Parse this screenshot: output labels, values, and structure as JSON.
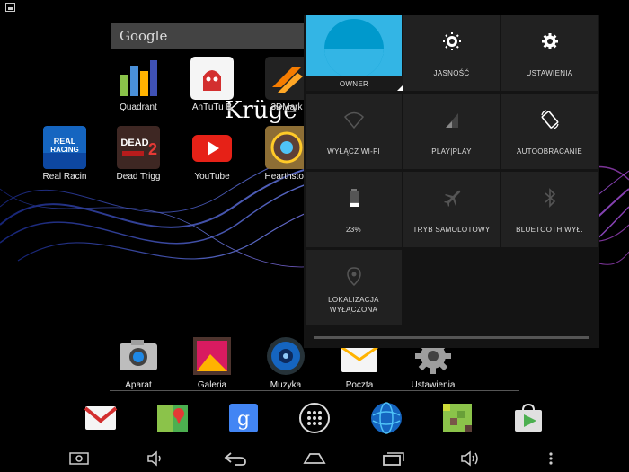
{
  "search": {
    "placeholder": "Google"
  },
  "wallpaper_text": "Krüge",
  "home_apps": [
    {
      "label": "Quadrant",
      "icon": "quadrant-icon",
      "color": "#4a90d9"
    },
    {
      "label": "AnTuTu B",
      "icon": "antutu-icon",
      "color": "#d32f2f"
    },
    {
      "label": "3DMark",
      "icon": "3dmark-icon",
      "color": "#f57c00"
    },
    {
      "label": "Real Racin",
      "icon": "real-racing-icon",
      "color": "#1565c0"
    },
    {
      "label": "Dead Trigg",
      "icon": "dead-trigger-icon",
      "color": "#b71c1c"
    },
    {
      "label": "YouTube",
      "icon": "youtube-icon",
      "color": "#e62117"
    },
    {
      "label": "Hearthston",
      "icon": "hearthstone-icon",
      "color": "#8d6e35"
    }
  ],
  "dock_apps": [
    {
      "label": "Aparat",
      "icon": "camera-icon"
    },
    {
      "label": "Galeria",
      "icon": "gallery-icon"
    },
    {
      "label": "Muzyka",
      "icon": "music-icon"
    },
    {
      "label": "Poczta",
      "icon": "mail-icon"
    },
    {
      "label": "Ustawienia",
      "icon": "settings-icon"
    }
  ],
  "hotseat": [
    {
      "icon": "gmail-icon"
    },
    {
      "icon": "maps-icon"
    },
    {
      "icon": "google-search-icon"
    },
    {
      "icon": "app-drawer-icon"
    },
    {
      "icon": "browser-globe-icon"
    },
    {
      "icon": "minecraft-icon"
    },
    {
      "icon": "play-store-icon"
    }
  ],
  "quick_settings": {
    "owner": {
      "label": "OWNER"
    },
    "brightness": {
      "label": "JASNOŚĆ",
      "icon": "brightness-icon"
    },
    "settings": {
      "label": "USTAWIENIA",
      "icon": "gear-icon"
    },
    "wifi": {
      "label": "WYŁĄCZ WI-FI",
      "icon": "wifi-off-icon"
    },
    "mobile": {
      "label": "PLAY|PLAY",
      "icon": "signal-icon"
    },
    "rotation": {
      "label": "AUTOOBRACANIE",
      "icon": "auto-rotate-icon"
    },
    "battery": {
      "label": "23%",
      "icon": "battery-icon",
      "level": 0.23
    },
    "airplane": {
      "label": "TRYB SAMOLOTOWY",
      "icon": "airplane-icon"
    },
    "bluetooth": {
      "label": "BLUETOOTH WYŁ.",
      "icon": "bluetooth-icon"
    },
    "location": {
      "label_line1": "LOKALIZACJA",
      "label_line2": "WYŁĄCZONA",
      "icon": "location-icon"
    }
  },
  "navbar": [
    {
      "icon": "screenshot-icon"
    },
    {
      "icon": "volume-down-icon"
    },
    {
      "icon": "back-icon"
    },
    {
      "icon": "home-icon"
    },
    {
      "icon": "recent-apps-icon"
    },
    {
      "icon": "volume-up-icon"
    },
    {
      "icon": "menu-icon"
    }
  ],
  "colors": {
    "accent": "#33b5e5",
    "tile": "#212121",
    "panel": "#141414"
  }
}
